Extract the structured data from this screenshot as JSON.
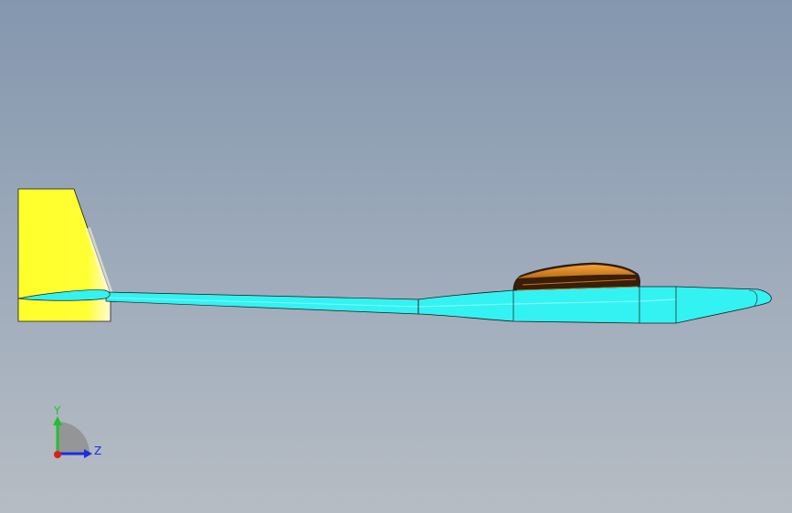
{
  "viewport": {
    "model": "glider",
    "view_orientation": "side",
    "colors": {
      "fuselage": "#33f2f2",
      "fin": "#ffff33",
      "canopy": "#e8921e",
      "canopy_frame": "#3a1e08",
      "outline": "#1a1a1a"
    }
  },
  "triad": {
    "y_label": "Y",
    "z_label": "Z",
    "colors": {
      "y": "#22c02b",
      "z": "#1a2ee0",
      "x": "#e01b1b"
    }
  }
}
